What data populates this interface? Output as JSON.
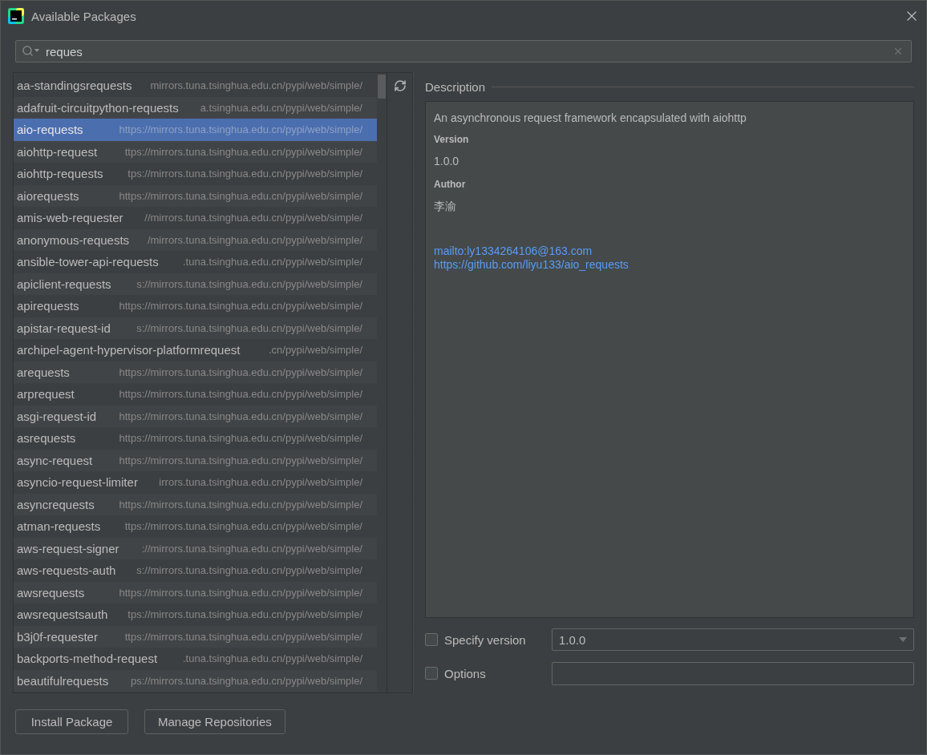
{
  "window": {
    "title": "Available Packages"
  },
  "search": {
    "value": "reques"
  },
  "packages": [
    {
      "name": "aa-standingsrequests",
      "repository": "mirrors.tuna.tsinghua.edu.cn/pypi/web/simple/",
      "selected": false
    },
    {
      "name": "adafruit-circuitpython-requests",
      "repository": "a.tsinghua.edu.cn/pypi/web/simple/",
      "selected": false
    },
    {
      "name": "aio-requests",
      "repository": "https://mirrors.tuna.tsinghua.edu.cn/pypi/web/simple/",
      "selected": true
    },
    {
      "name": "aiohttp-request",
      "repository": "ttps://mirrors.tuna.tsinghua.edu.cn/pypi/web/simple/",
      "selected": false
    },
    {
      "name": "aiohttp-requests",
      "repository": "tps://mirrors.tuna.tsinghua.edu.cn/pypi/web/simple/",
      "selected": false
    },
    {
      "name": "aiorequests",
      "repository": "https://mirrors.tuna.tsinghua.edu.cn/pypi/web/simple/",
      "selected": false
    },
    {
      "name": "amis-web-requester",
      "repository": "//mirrors.tuna.tsinghua.edu.cn/pypi/web/simple/",
      "selected": false
    },
    {
      "name": "anonymous-requests",
      "repository": "/mirrors.tuna.tsinghua.edu.cn/pypi/web/simple/",
      "selected": false
    },
    {
      "name": "ansible-tower-api-requests",
      "repository": ".tuna.tsinghua.edu.cn/pypi/web/simple/",
      "selected": false
    },
    {
      "name": "apiclient-requests",
      "repository": "s://mirrors.tuna.tsinghua.edu.cn/pypi/web/simple/",
      "selected": false
    },
    {
      "name": "apirequests",
      "repository": "https://mirrors.tuna.tsinghua.edu.cn/pypi/web/simple/",
      "selected": false
    },
    {
      "name": "apistar-request-id",
      "repository": "s://mirrors.tuna.tsinghua.edu.cn/pypi/web/simple/",
      "selected": false
    },
    {
      "name": "archipel-agent-hypervisor-platformrequest",
      "repository": ".cn/pypi/web/simple/",
      "selected": false
    },
    {
      "name": "arequests",
      "repository": "https://mirrors.tuna.tsinghua.edu.cn/pypi/web/simple/",
      "selected": false
    },
    {
      "name": "arprequest",
      "repository": "https://mirrors.tuna.tsinghua.edu.cn/pypi/web/simple/",
      "selected": false
    },
    {
      "name": "asgi-request-id",
      "repository": "https://mirrors.tuna.tsinghua.edu.cn/pypi/web/simple/",
      "selected": false
    },
    {
      "name": "asrequests",
      "repository": "https://mirrors.tuna.tsinghua.edu.cn/pypi/web/simple/",
      "selected": false
    },
    {
      "name": "async-request",
      "repository": "https://mirrors.tuna.tsinghua.edu.cn/pypi/web/simple/",
      "selected": false
    },
    {
      "name": "asyncio-request-limiter",
      "repository": "irrors.tuna.tsinghua.edu.cn/pypi/web/simple/",
      "selected": false
    },
    {
      "name": "asyncrequests",
      "repository": "https://mirrors.tuna.tsinghua.edu.cn/pypi/web/simple/",
      "selected": false
    },
    {
      "name": "atman-requests",
      "repository": "ttps://mirrors.tuna.tsinghua.edu.cn/pypi/web/simple/",
      "selected": false
    },
    {
      "name": "aws-request-signer",
      "repository": "://mirrors.tuna.tsinghua.edu.cn/pypi/web/simple/",
      "selected": false
    },
    {
      "name": "aws-requests-auth",
      "repository": "s://mirrors.tuna.tsinghua.edu.cn/pypi/web/simple/",
      "selected": false
    },
    {
      "name": "awsrequests",
      "repository": "https://mirrors.tuna.tsinghua.edu.cn/pypi/web/simple/",
      "selected": false
    },
    {
      "name": "awsrequestsauth",
      "repository": "tps://mirrors.tuna.tsinghua.edu.cn/pypi/web/simple/",
      "selected": false
    },
    {
      "name": "b3j0f-requester",
      "repository": "ttps://mirrors.tuna.tsinghua.edu.cn/pypi/web/simple/",
      "selected": false
    },
    {
      "name": "backports-method-request",
      "repository": ".tuna.tsinghua.edu.cn/pypi/web/simple/",
      "selected": false
    },
    {
      "name": "beautifulrequests",
      "repository": "ps://mirrors.tuna.tsinghua.edu.cn/pypi/web/simple/",
      "selected": false
    }
  ],
  "description": {
    "heading": "Description",
    "summary": "An asynchronous request framework encapsulated with aiohttp",
    "fields": [
      {
        "label": "Version",
        "value": "1.0.0"
      },
      {
        "label": "Author",
        "value": "李渝"
      }
    ],
    "links": [
      "mailto:ly1334264106@163.com",
      "https://github.com/liyu133/aio_requests"
    ]
  },
  "specify_version": {
    "label": "Specify version",
    "checked": false,
    "value": "1.0.0"
  },
  "options": {
    "label": "Options",
    "checked": false
  },
  "buttons": [
    {
      "label": "Install Package"
    },
    {
      "label": "Manage Repositories"
    }
  ]
}
